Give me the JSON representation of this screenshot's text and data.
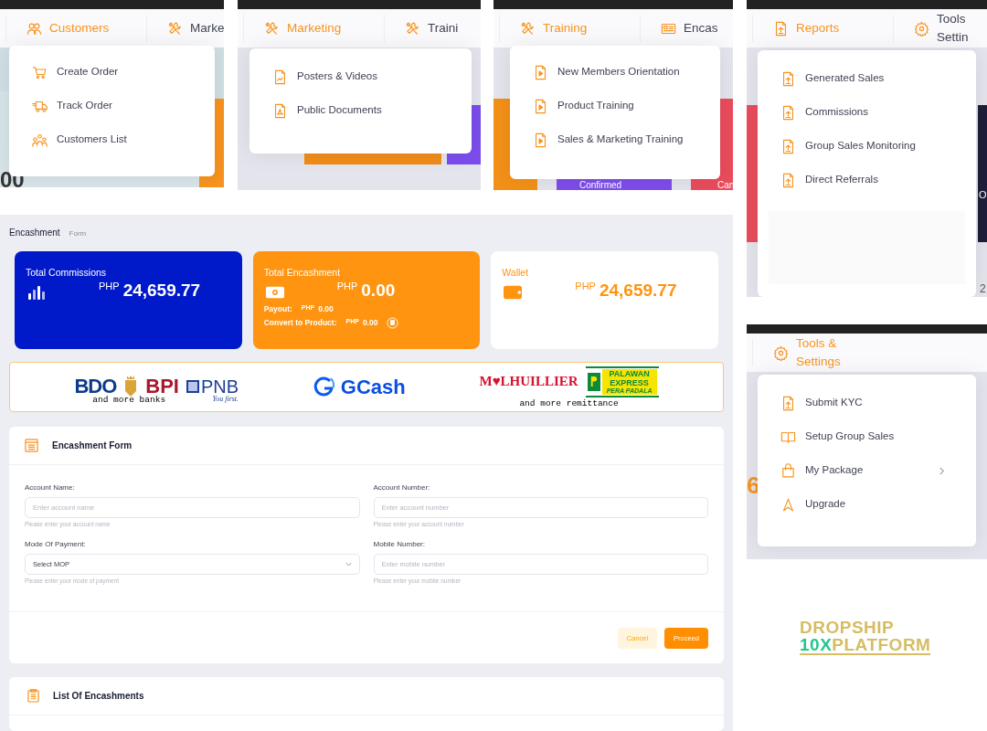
{
  "menu_panels": [
    {
      "nav": [
        {
          "label": "Customers",
          "kind": "users",
          "selected": true
        },
        {
          "label": "Marke",
          "kind": "tools",
          "selected": false
        }
      ],
      "menu": [
        {
          "label": "Create Order",
          "kind": "cart",
          "submenu": false
        },
        {
          "label": "Track Order",
          "kind": "truck",
          "submenu": false
        },
        {
          "label": "Customers List",
          "kind": "group",
          "submenu": false
        }
      ],
      "background_texts": [
        "00"
      ]
    },
    {
      "nav": [
        {
          "label": "Marketing",
          "kind": "tools",
          "selected": true
        },
        {
          "label": "Traini",
          "kind": "tools",
          "selected": false
        }
      ],
      "menu": [
        {
          "label": "Posters & Videos",
          "kind": "image-file",
          "submenu": false
        },
        {
          "label": "Public Documents",
          "kind": "pdf-file",
          "submenu": false
        }
      ]
    },
    {
      "nav": [
        {
          "label": "Training",
          "kind": "tools",
          "selected": true
        },
        {
          "label": "Encas",
          "kind": "card",
          "selected": false
        }
      ],
      "menu": [
        {
          "label": "New Members Orientation",
          "kind": "play-file",
          "submenu": false
        },
        {
          "label": "Product Training",
          "kind": "play-file",
          "submenu": false
        },
        {
          "label": "Sales & Marketing Training",
          "kind": "play-file",
          "submenu": false
        }
      ],
      "background_texts": [
        "Confirmed",
        "Can"
      ]
    },
    {
      "nav": [
        {
          "label": "Reports",
          "kind": "upload-file",
          "selected": true
        },
        {
          "label": "Tools Settin",
          "kind": "gear",
          "selected": false
        }
      ],
      "menu": [
        {
          "label": "Generated Sales",
          "kind": "upload-file",
          "submenu": false
        },
        {
          "label": "Commissions",
          "kind": "upload-file",
          "submenu": false
        },
        {
          "label": "Group Sales Monitoring",
          "kind": "upload-file",
          "submenu": false
        },
        {
          "label": "Direct Referrals",
          "kind": "upload-file",
          "submenu": false
        }
      ],
      "background_texts": [
        "O",
        "2"
      ]
    },
    {
      "nav": [
        {
          "label": "Tools & Settings",
          "kind": "gear",
          "selected": true
        }
      ],
      "menu": [
        {
          "label": "Submit KYC",
          "kind": "upload-file",
          "submenu": false
        },
        {
          "label": "Setup Group Sales",
          "kind": "book",
          "submenu": false
        },
        {
          "label": "My Package",
          "kind": "bag",
          "submenu": true
        },
        {
          "label": "Upgrade",
          "kind": "arrow-up",
          "submenu": false
        }
      ],
      "background_texts": [
        "6"
      ]
    }
  ],
  "breadcrumb": {
    "title": "Encashment",
    "subtitle": "Form"
  },
  "stat_cards": [
    {
      "kind": "commissions",
      "title": "Total Commissions",
      "currency": "PHP",
      "amount": "24,659.77"
    },
    {
      "kind": "encashment",
      "title": "Total Encashment",
      "currency": "PHP",
      "amount": "0.00",
      "details": [
        {
          "label": "Payout:",
          "currency": "PHP",
          "amount": "0.00",
          "copy": false
        },
        {
          "label": "Convert to Product:",
          "currency": "PHP",
          "amount": "0.00",
          "copy": true
        }
      ]
    },
    {
      "kind": "wallet",
      "title": "Wallet",
      "currency": "PHP",
      "amount": "24,659.77"
    }
  ],
  "payment_partners": {
    "banks": [
      {
        "kind": "bdo",
        "label": "BDO"
      },
      {
        "kind": "bpi",
        "label": "BPI"
      },
      {
        "kind": "pnb",
        "label": "PNB",
        "tagline": "You first."
      }
    ],
    "banks_note": "and more banks",
    "ewallet": {
      "label": "GCash"
    },
    "remittances": [
      {
        "kind": "mlhuillier",
        "label": "M♥LHUILLIER"
      },
      {
        "kind": "palawan",
        "label": "PALAWAN EXPRESS",
        "tagline": "PERA PADALA"
      }
    ],
    "remittance_note": "and more remittance"
  },
  "encashment_form": {
    "title": "Encashment Form",
    "fields": [
      {
        "kind": "input",
        "label": "Account Name:",
        "placeholder": "Enter account name",
        "help": "Please enter your account name"
      },
      {
        "kind": "input",
        "label": "Account Number:",
        "placeholder": "Enter account number",
        "help": "Please enter your account number"
      },
      {
        "kind": "select",
        "label": "Mode Of Payment:",
        "value": "Select MOP",
        "help": "Please enter your mode of payment"
      },
      {
        "kind": "input",
        "label": "Mobile Number:",
        "placeholder": "Enter mobile number",
        "help": "Please enter your mobile number"
      }
    ],
    "buttons": [
      {
        "label": "Cancel",
        "kind": "secondary"
      },
      {
        "label": "Proceed",
        "kind": "primary"
      }
    ]
  },
  "encashments_list": {
    "title": "List Of Encashments"
  },
  "logo": {
    "line1": "DROPSHIP",
    "accent": "10X",
    "line2": "PLATFORM"
  }
}
